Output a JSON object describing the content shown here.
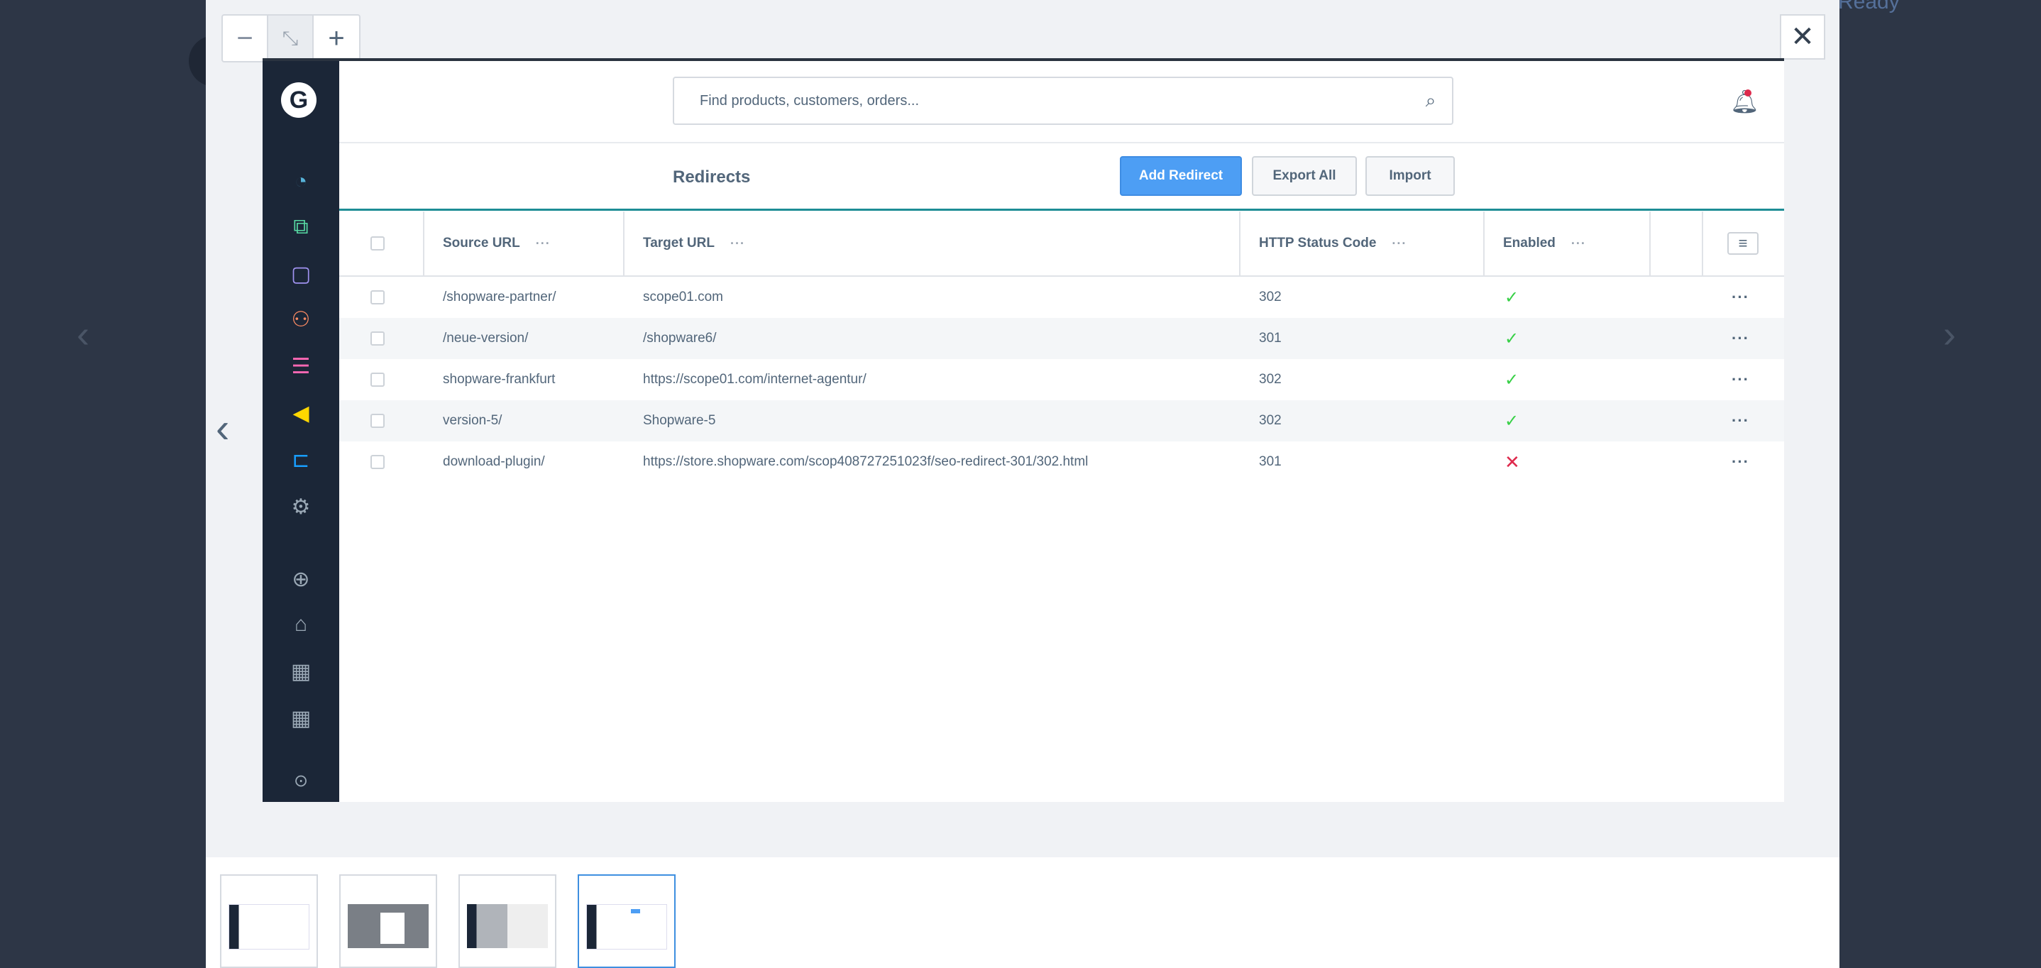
{
  "viewer": {
    "zoom_out": "−",
    "zoom_reset": "⤡",
    "zoom_in": "+",
    "close": "✕",
    "prev": "‹",
    "next": "›",
    "thumbnails": [
      {
        "label": ""
      },
      {
        "label": ""
      },
      {
        "label": ""
      },
      {
        "label": ""
      }
    ]
  },
  "background": {
    "ready_text": "Ready"
  },
  "search": {
    "placeholder": "Find products, customers, orders..."
  },
  "sidebar": {
    "logo": "G",
    "items": [
      {
        "icon": "dashboard-icon",
        "color": "#57b3d9"
      },
      {
        "icon": "catalogue-icon",
        "color": "#57d9a3"
      },
      {
        "icon": "orders-icon",
        "color": "#a092f0"
      },
      {
        "icon": "customers-icon",
        "color": "#f88962"
      },
      {
        "icon": "content-icon",
        "color": "#ff68b4"
      },
      {
        "icon": "marketing-icon",
        "color": "#ffd700"
      },
      {
        "icon": "extensions-icon",
        "color": "#189eff"
      },
      {
        "icon": "settings-icon",
        "color": "#9aa8b5"
      },
      {
        "icon": "add-sales-channel-icon",
        "color": "#9aa8b5"
      },
      {
        "icon": "basket-icon",
        "color": "#9aa8b5"
      },
      {
        "icon": "storefront-icon",
        "color": "#9aa8b5"
      },
      {
        "icon": "storefront-icon-2",
        "color": "#9aa8b5"
      },
      {
        "icon": "collapse-icon",
        "color": "#9aa8b5"
      }
    ]
  },
  "toolbar": {
    "title": "Redirects",
    "add_label": "Add Redirect",
    "export_label": "Export All",
    "import_label": "Import"
  },
  "grid": {
    "columns": {
      "source": "Source URL",
      "target": "Target URL",
      "status": "HTTP Status Code",
      "enabled": "Enabled"
    },
    "rows": [
      {
        "source": "/shopware-partner/",
        "target": "scope01.com",
        "status": "302",
        "enabled": true
      },
      {
        "source": "/neue-version/",
        "target": "/shopware6/",
        "status": "301",
        "enabled": true
      },
      {
        "source": "shopware-frankfurt",
        "target": "https://scope01.com/internet-agentur/",
        "status": "302",
        "enabled": true
      },
      {
        "source": "version-5/",
        "target": "Shopware-5",
        "status": "302",
        "enabled": true
      },
      {
        "source": "download-plugin/",
        "target": "https://store.shopware.com/scop408727251023f/seo-redirect-301/302.html",
        "status": "301",
        "enabled": false
      }
    ]
  }
}
